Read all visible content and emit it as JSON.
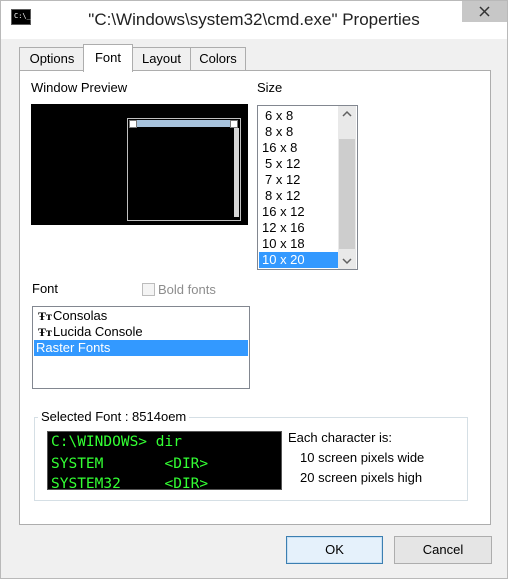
{
  "window": {
    "title": "\"C:\\Windows\\system32\\cmd.exe\" Properties",
    "icon_text": "C:\\_"
  },
  "tabs": [
    {
      "label": "Options",
      "active": false
    },
    {
      "label": "Font",
      "active": true
    },
    {
      "label": "Layout",
      "active": false
    },
    {
      "label": "Colors",
      "active": false
    }
  ],
  "font_tab": {
    "window_preview_label": "Window Preview",
    "size_label": "Size",
    "sizes": [
      "6 x 8",
      "8 x 8",
      "16 x 8",
      "5 x 12",
      "7 x 12",
      "8 x 12",
      "16 x 12",
      "12 x 16",
      "10 x 18",
      "10 x 20"
    ],
    "selected_size": "10 x 20",
    "font_label": "Font",
    "bold_fonts_label": "Bold fonts",
    "fonts": [
      "Consolas",
      "Lucida Console",
      "Raster Fonts"
    ],
    "selected_font": "Raster Fonts",
    "selected_font_group": "Selected Font : 8514oem",
    "sample_lines": [
      "C:\\WINDOWS> dir",
      "SYSTEM       <DIR>",
      "SYSTEM32     <DIR>"
    ],
    "char_info": {
      "heading": "Each character is:",
      "width": "10 screen pixels wide",
      "height": "20 screen pixels high"
    }
  },
  "buttons": {
    "ok": "OK",
    "cancel": "Cancel"
  },
  "colors": {
    "selection": "#3399ff",
    "sample_text": "#33ff33",
    "preview_titlebar": "#a7c3dd"
  }
}
